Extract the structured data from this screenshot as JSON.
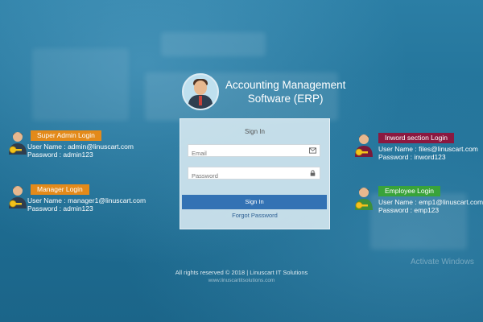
{
  "app": {
    "title_line1": "Accounting Management",
    "title_line2": "Software (ERP)"
  },
  "signin": {
    "title": "Sign In",
    "email_placeholder": "Email",
    "password_placeholder": "Password",
    "button_label": "Sign In",
    "forgot_label": "Forgot Password"
  },
  "logins": {
    "super_admin": {
      "title": "Super Admin Login",
      "user_label": "User Name : admin@linuscart.com",
      "pass_label": "Password   : admin123",
      "color": "#e38a1a"
    },
    "manager": {
      "title": "Manager Login",
      "user_label": "User Name : manager1@linuscart.com",
      "pass_label": "Password   : admin123",
      "color": "#e38a1a"
    },
    "inword": {
      "title": "Inword section Login",
      "user_label": "User Name : files@linuscart.com",
      "pass_label": "Password   : inword123",
      "color": "#8b1840"
    },
    "employee": {
      "title": "Employee Login",
      "user_label": "User Name : emp1@linuscart.com",
      "pass_label": "Password   : emp123",
      "color": "#39a33a"
    }
  },
  "footer": {
    "copyright": "All rights reserved © 2018 | Linuscart IT Solutions",
    "website": "www.linuscartitsolutions.com"
  },
  "watermark": "Activate Windows"
}
